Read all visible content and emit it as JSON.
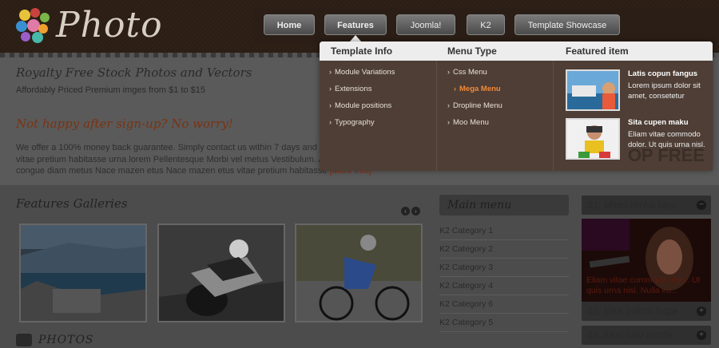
{
  "header": {
    "logo_text": "Photo",
    "nav": [
      "Home",
      "Features",
      "Joomla!",
      "K2",
      "Template Showcase"
    ]
  },
  "intro": {
    "title": "Royalty Free Stock Photos and Vectors",
    "subtitle": "Affordably Priced Premium imges from $1 to $15",
    "promo_title": "Not happy after sign-up? No worry!",
    "paragraph": "We offer a 100% money back guarantee. Simply contact us within 7 days and we will refund your money Nace mazen etus vitae pretium habitasse urna lorem Pellentesque Morbi vel metus Vestibulum. Ac tellus ut ut condimentum sed eget dolor congue diam metus Nace mazen etus Nace mazen etus vitae pretium habitasse",
    "more": "[More info]"
  },
  "mega_menu": {
    "col1_title": "Template Info",
    "col1_items": [
      "Module Variations",
      "Extensions",
      "Module positions",
      "Typography"
    ],
    "col2_title": "Menu Type",
    "col2_items": [
      "Css Menu",
      "Mega Menu",
      "Dropline Menu",
      "Moo Menu"
    ],
    "col3_title": "Featured item",
    "featured": [
      {
        "title": "Latis copun fangus",
        "desc": "Lorem ipsum dolor sit amet, consetetur"
      },
      {
        "title": "Sita cupen maku",
        "desc": "Eliam vitae commodo dolor. Ut quis urna nisl."
      }
    ]
  },
  "gallery": {
    "title": "Features Galleries",
    "prev": "‹",
    "next": "›"
  },
  "main_menu": {
    "title": "Main menu",
    "items": [
      "K2 Category 1",
      "K2 Category 2",
      "K2 Category 3",
      "K2 Category 4",
      "K2 Category 6",
      "K2 Category 5"
    ]
  },
  "accordion": {
    "items": [
      "01. Mites ronka lapo",
      "02. Eika pakon hape",
      "03. Akal baki rande"
    ],
    "caption": "Eliam vitae commodo dolor. Ut quis urna nisl. Nulla eu..."
  },
  "photos_label": "PHOTOS",
  "watermark": "OP FREE"
}
